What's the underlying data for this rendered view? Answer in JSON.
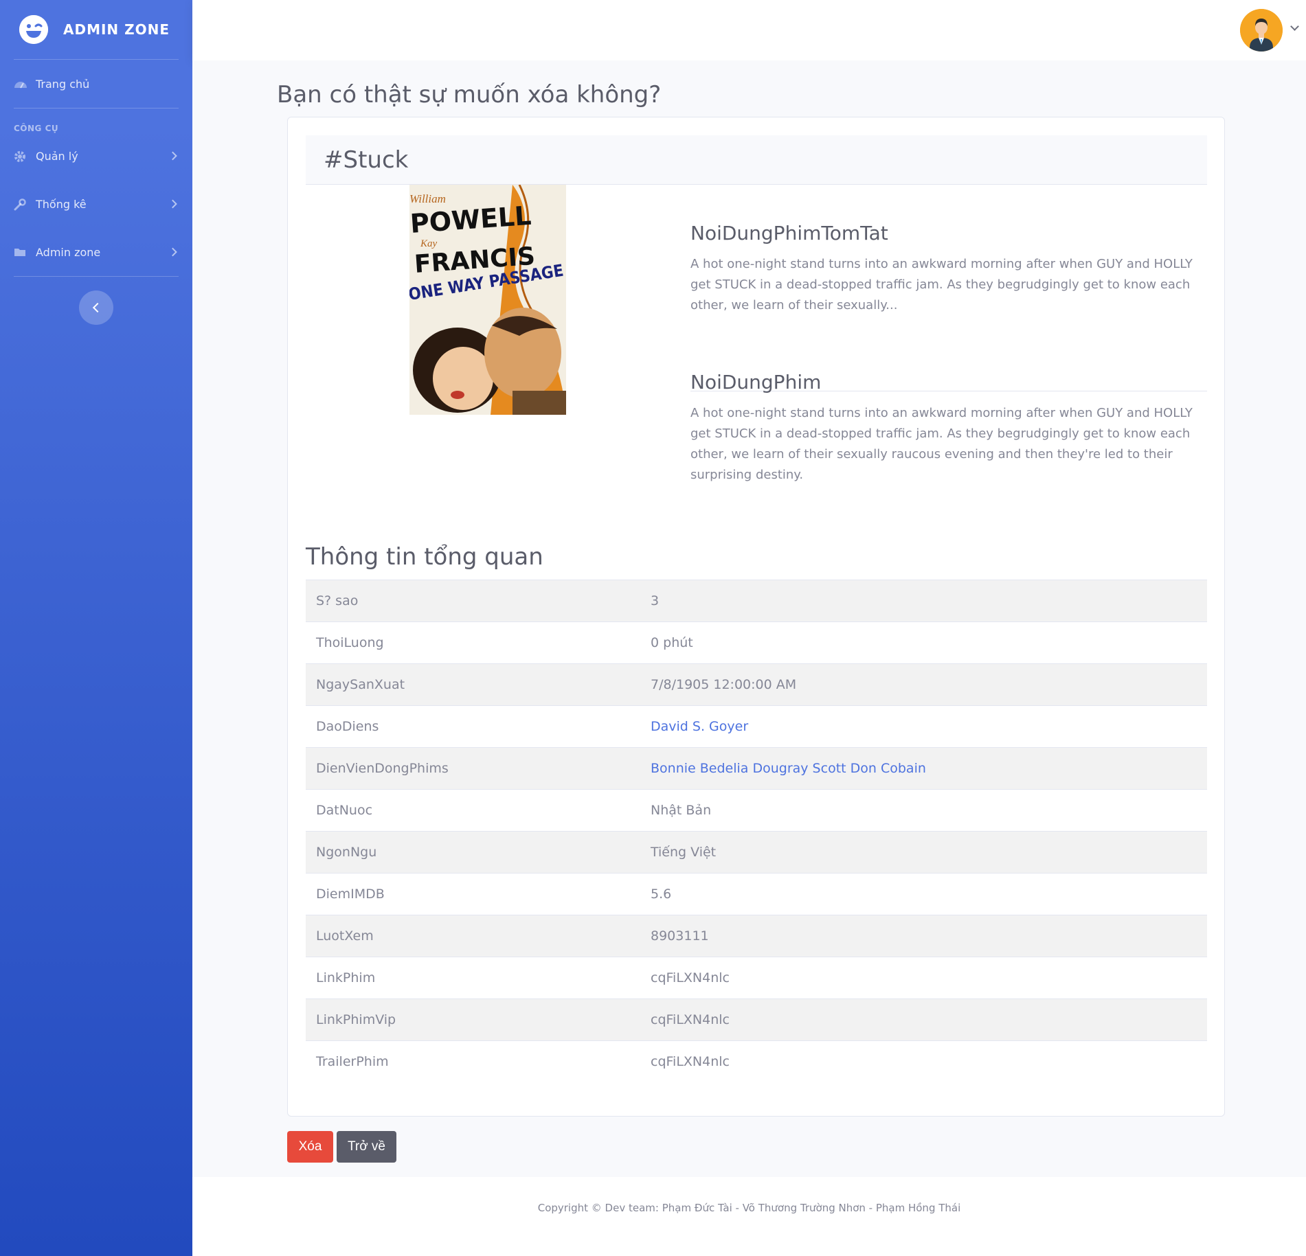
{
  "sidebar": {
    "brand": "ADMIN ZONE",
    "home": "Trang chủ",
    "heading": "CÔNG CỤ",
    "items": [
      {
        "label": "Quản lý"
      },
      {
        "label": "Thống kê"
      },
      {
        "label": "Admin zone"
      }
    ]
  },
  "page": {
    "title": "Bạn có thật sự muốn xóa không?",
    "movie_title": "#Stuck",
    "synopsis_short": {
      "heading": "NoiDungPhimTomTat",
      "text": "A hot one-night stand turns into an awkward morning after when GUY and HOLLY get STUCK in a dead-stopped traffic jam. As they begrudgingly get to know each other, we learn of their sexually..."
    },
    "synopsis_full": {
      "heading": "NoiDungPhim",
      "text": "A hot one-night stand turns into an awkward morning after when GUY and HOLLY get STUCK in a dead-stopped traffic jam. As they begrudgingly get to know each other, we learn of their sexually raucous evening and then they're led to their surprising destiny."
    },
    "poster_text": {
      "line1": "William",
      "line2": "POWELL",
      "line3": "Kay",
      "line4": "FRANCIS",
      "line5": "ONE WAY PASSAGE"
    },
    "overview_title": "Thông tin tổng quan",
    "rows": [
      {
        "key": "S? sao",
        "value": "3"
      },
      {
        "key": "ThoiLuong",
        "value": "0 phút"
      },
      {
        "key": "NgaySanXuat",
        "value": "7/8/1905 12:00:00 AM"
      },
      {
        "key": "DaoDiens",
        "value": "David S. Goyer"
      },
      {
        "key": "DienVienDongPhims",
        "value": "Bonnie Bedelia Dougray Scott Don Cobain"
      },
      {
        "key": "DatNuoc",
        "value": "Nhật Bản"
      },
      {
        "key": "NgonNgu",
        "value": "Tiếng Việt"
      },
      {
        "key": "DiemIMDB",
        "value": "5.6"
      },
      {
        "key": "LuotXem",
        "value": "8903111"
      },
      {
        "key": "LinkPhim",
        "value": "cqFiLXN4nlc"
      },
      {
        "key": "LinkPhimVip",
        "value": "cqFiLXN4nlc"
      },
      {
        "key": "TrailerPhim",
        "value": "cqFiLXN4nlc"
      }
    ],
    "delete_button": "Xóa",
    "back_button": "Trở về"
  },
  "footer": {
    "copyright": "Copyright © Dev team: Phạm Đức Tài - Võ Thương Trường Nhơn - Phạm Hồng Thái"
  },
  "colors": {
    "primary": "#4e73df",
    "danger": "#e74a3b",
    "secondary": "#5a5c69"
  },
  "icons": [
    "laugh-wink-icon",
    "tachometer-icon",
    "gear-icon",
    "wrench-icon",
    "folder-icon",
    "chevron-right-icon",
    "chevron-left-icon",
    "user-avatar-icon",
    "chevron-down-icon"
  ]
}
